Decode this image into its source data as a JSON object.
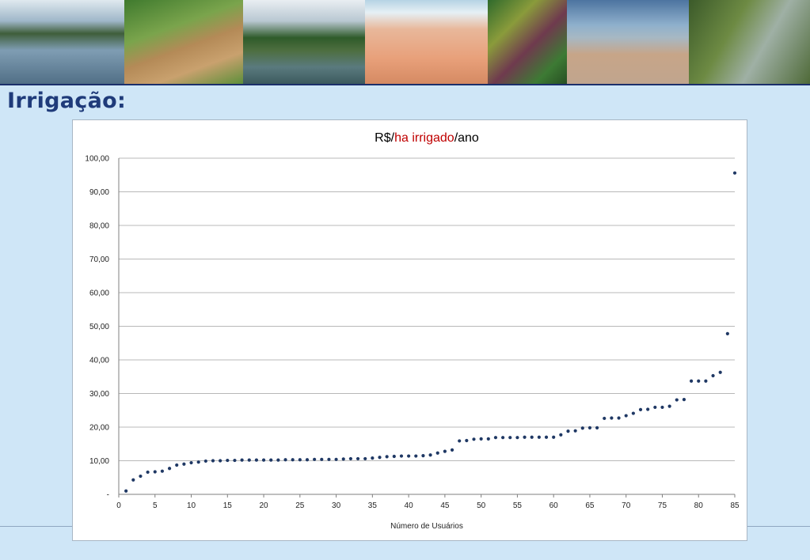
{
  "page": {
    "heading": "Irrigação:"
  },
  "banner": {
    "photos": [
      "river-boat-photo",
      "bridge-crowd-photo",
      "river-trees-photo",
      "water-intake-photo",
      "bananas-photo",
      "river-landscape-photo",
      "riverside-forest-photo"
    ]
  },
  "colors": {
    "heading": "#1f3b7a",
    "marker": "#1f3864",
    "title_highlight": "#c00000",
    "gridline": "#b8b8b8"
  },
  "chart_data": {
    "type": "scatter",
    "title_parts": [
      {
        "text": "R$/",
        "highlight": false
      },
      {
        "text": "ha irrigado",
        "highlight": true
      },
      {
        "text": "/ano",
        "highlight": false
      }
    ],
    "xlabel": "Número de Usuários",
    "ylabel": "",
    "xlim": [
      0,
      85
    ],
    "ylim": [
      0,
      100
    ],
    "xticks": [
      0,
      5,
      10,
      15,
      20,
      25,
      30,
      35,
      40,
      45,
      50,
      55,
      60,
      65,
      70,
      75,
      80,
      85
    ],
    "yticks": [
      0,
      10,
      20,
      30,
      40,
      50,
      60,
      70,
      80,
      90,
      100
    ],
    "ytick_labels": [
      "-",
      "10,00",
      "20,00",
      "30,00",
      "40,00",
      "50,00",
      "60,00",
      "70,00",
      "80,00",
      "90,00",
      "100,00"
    ],
    "grid": true,
    "legend": false,
    "x": [
      1,
      2,
      3,
      4,
      5,
      6,
      7,
      8,
      9,
      10,
      11,
      12,
      13,
      14,
      15,
      16,
      17,
      18,
      19,
      20,
      21,
      22,
      23,
      24,
      25,
      26,
      27,
      28,
      29,
      30,
      31,
      32,
      33,
      34,
      35,
      36,
      37,
      38,
      39,
      40,
      41,
      42,
      43,
      44,
      45,
      46,
      47,
      48,
      49,
      50,
      51,
      52,
      53,
      54,
      55,
      56,
      57,
      58,
      59,
      60,
      61,
      62,
      63,
      64,
      65,
      66,
      67,
      68,
      69,
      70,
      71,
      72,
      73,
      74,
      75,
      76,
      77,
      78,
      79,
      80,
      81,
      82,
      83,
      84,
      85
    ],
    "y": [
      1.0,
      4.3,
      5.4,
      6.6,
      6.7,
      6.9,
      7.7,
      8.7,
      9.0,
      9.4,
      9.6,
      9.9,
      10.0,
      10.0,
      10.1,
      10.1,
      10.2,
      10.2,
      10.2,
      10.2,
      10.2,
      10.2,
      10.3,
      10.3,
      10.3,
      10.3,
      10.4,
      10.4,
      10.4,
      10.4,
      10.5,
      10.6,
      10.6,
      10.6,
      10.8,
      11.0,
      11.2,
      11.3,
      11.4,
      11.4,
      11.4,
      11.5,
      11.7,
      12.3,
      12.8,
      13.2,
      15.9,
      16.0,
      16.4,
      16.5,
      16.5,
      16.9,
      16.9,
      16.9,
      16.9,
      17.0,
      17.0,
      17.0,
      17.0,
      17.0,
      17.7,
      18.8,
      18.9,
      19.7,
      19.8,
      19.8,
      22.6,
      22.7,
      22.7,
      23.4,
      24.1,
      25.2,
      25.3,
      25.9,
      25.9,
      26.2,
      28.1,
      28.2,
      33.7,
      33.7,
      33.7,
      35.3,
      36.3,
      47.8,
      95.6
    ]
  }
}
